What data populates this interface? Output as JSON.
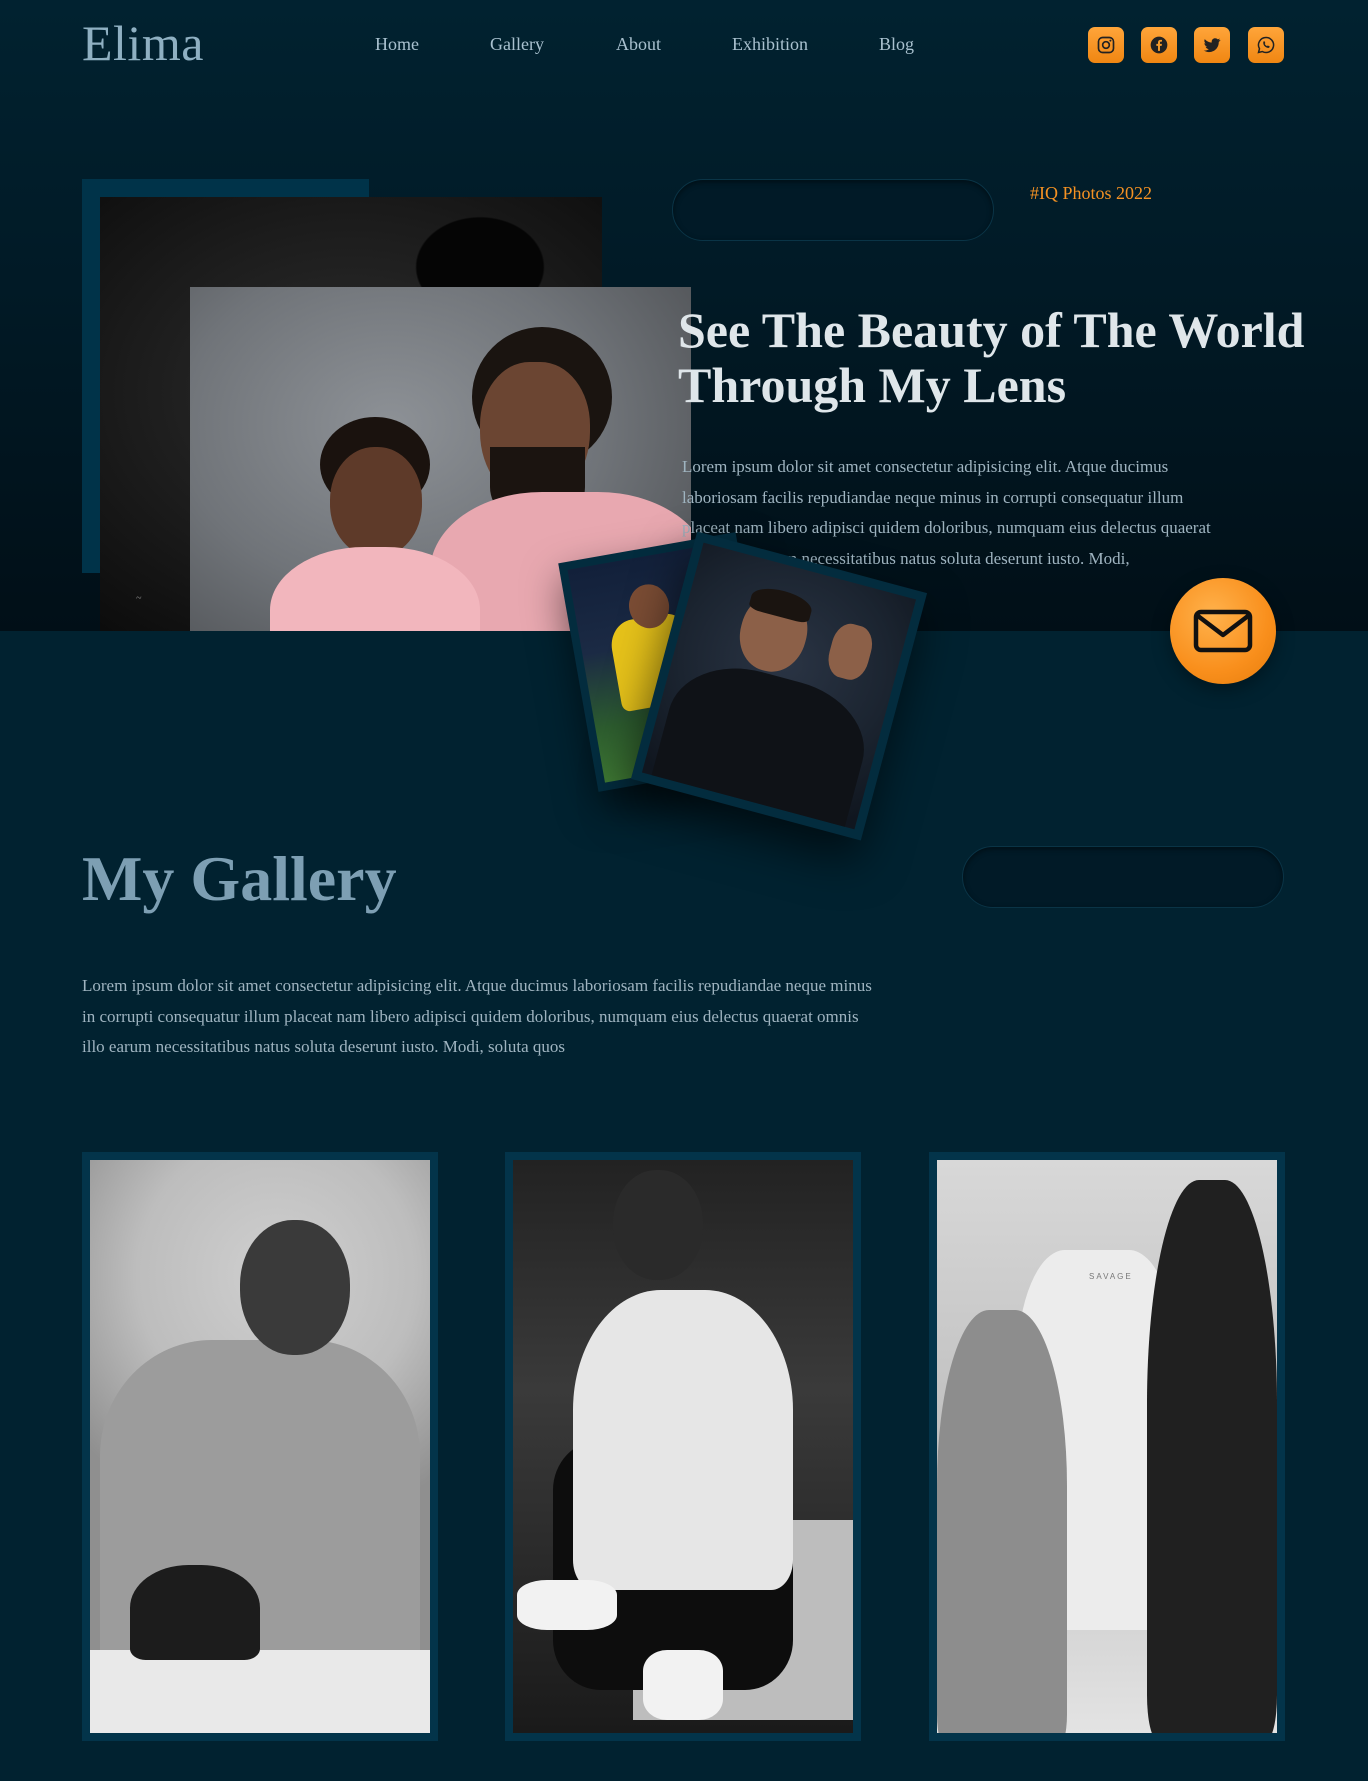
{
  "brand": {
    "logo": "Elima"
  },
  "nav": {
    "links": [
      {
        "label": "Home"
      },
      {
        "label": "Gallery"
      },
      {
        "label": "About"
      },
      {
        "label": "Exhibition"
      },
      {
        "label": "Blog"
      }
    ]
  },
  "social": {
    "icons": [
      "instagram-icon",
      "facebook-icon",
      "twitter-icon",
      "whatsapp-icon"
    ],
    "accent_color": "#f59223"
  },
  "hero": {
    "hashtag": "#IQ Photos 2022",
    "title": "See The Beauty of The World Through My Lens",
    "text": "Lorem ipsum dolor sit amet consectetur adipisicing elit. Atque ducimus laboriosam facilis repudiandae neque minus in corrupti consequatur illum placeat nam libero adipisci quidem doloribus, numquam eius delectus quaerat omnis illo earum necessitatibus natus soluta deserunt iusto. Modi,"
  },
  "gallery": {
    "title": "My Gallery",
    "text": "Lorem ipsum dolor sit amet consectetur adipisicing elit. Atque ducimus laboriosam facilis repudiandae neque minus in corrupti consequatur illum placeat nam libero adipisci quidem doloribus, numquam eius delectus quaerat omnis illo earum necessitatibus natus soluta deserunt iusto. Modi, soluta quos",
    "photo3_seat_text": "SAVAGE"
  },
  "colors": {
    "background": "#012230",
    "accent": "#f59223",
    "logo": "#8fb0c2",
    "card_frame": "#03344a"
  }
}
